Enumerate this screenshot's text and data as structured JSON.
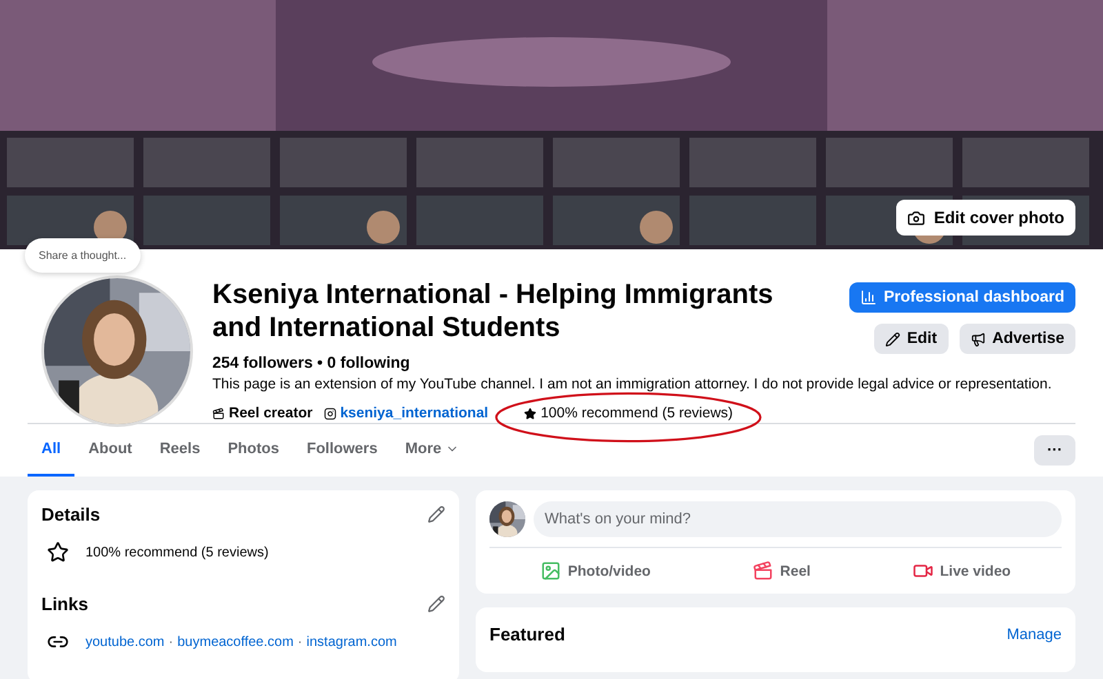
{
  "cover": {
    "kind": "picture",
    "edit_button": "Edit cover photo"
  },
  "thought_bubble": "Share a thought...",
  "profile": {
    "name": "Kseniya International - Helping Immigrants and International Students",
    "stats": "254 followers • 0 following",
    "bio": "This page is an extension of my YouTube channel. I am not an immigration attorney. I do not provide legal advice or representation.",
    "category": "Reel creator",
    "instagram": "kseniya_international",
    "rating": "100% recommend (5 reviews)",
    "rating_circled": true
  },
  "actions": {
    "primary": "Professional dashboard",
    "secondary": [
      "Edit",
      "Advertise"
    ]
  },
  "tabs": [
    {
      "label": "All",
      "selected": true
    },
    {
      "label": "About",
      "selected": false
    },
    {
      "label": "Reels",
      "selected": false
    },
    {
      "label": "Photos",
      "selected": false
    },
    {
      "label": "Followers",
      "selected": false
    },
    {
      "label": "More",
      "selected": false,
      "dropdown": true
    }
  ],
  "more_button": "···",
  "details": {
    "title": "Details",
    "rating": "100% recommend (5 reviews)"
  },
  "links": {
    "title": "Links",
    "items": [
      "youtube.com",
      "buymeacoffee.com",
      "instagram.com"
    ],
    "separator": "·"
  },
  "composer": {
    "placeholder": "What's on your mind?",
    "actions": [
      {
        "label": "Photo/video"
      },
      {
        "kind": "reel",
        "label": "Reel"
      },
      {
        "kind": "live",
        "label": "Live video"
      }
    ]
  },
  "featured": {
    "title": "Featured",
    "action": "Manage"
  }
}
